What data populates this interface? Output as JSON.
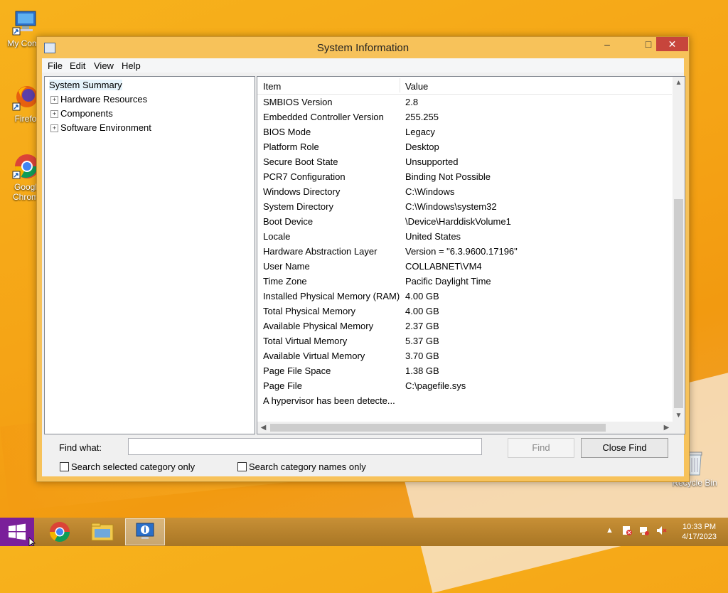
{
  "desktop": {
    "icons": [
      {
        "label": "My Comp",
        "icon": "computer-icon"
      },
      {
        "label": "Firefo",
        "icon": "firefox-icon"
      },
      {
        "label": "Googl",
        "label2": "Chrom",
        "icon": "chrome-icon"
      },
      {
        "label": "Recycle Bin",
        "icon": "recycle-bin-icon"
      }
    ]
  },
  "window": {
    "title": "System Information",
    "controls": {
      "minimize": "–",
      "maximize": "□",
      "close": "✕"
    },
    "menu": [
      "File",
      "Edit",
      "View",
      "Help"
    ]
  },
  "tree": {
    "root": "System Summary",
    "children": [
      "Hardware Resources",
      "Components",
      "Software Environment"
    ]
  },
  "list": {
    "columns": [
      "Item",
      "Value"
    ],
    "rows": [
      {
        "item": "SMBIOS Version",
        "value": "2.8"
      },
      {
        "item": "Embedded Controller Version",
        "value": "255.255"
      },
      {
        "item": "BIOS Mode",
        "value": "Legacy"
      },
      {
        "item": "Platform Role",
        "value": "Desktop"
      },
      {
        "item": "Secure Boot State",
        "value": "Unsupported"
      },
      {
        "item": "PCR7 Configuration",
        "value": "Binding Not Possible"
      },
      {
        "item": "Windows Directory",
        "value": "C:\\Windows"
      },
      {
        "item": "System Directory",
        "value": "C:\\Windows\\system32"
      },
      {
        "item": "Boot Device",
        "value": "\\Device\\HarddiskVolume1"
      },
      {
        "item": "Locale",
        "value": "United States"
      },
      {
        "item": "Hardware Abstraction Layer",
        "value": "Version = \"6.3.9600.17196\""
      },
      {
        "item": "User Name",
        "value": "COLLABNET\\VM4"
      },
      {
        "item": "Time Zone",
        "value": "Pacific Daylight Time"
      },
      {
        "item": "Installed Physical Memory (RAM)",
        "value": "4.00 GB"
      },
      {
        "item": "Total Physical Memory",
        "value": "4.00 GB"
      },
      {
        "item": "Available Physical Memory",
        "value": "2.37 GB"
      },
      {
        "item": "Total Virtual Memory",
        "value": "5.37 GB"
      },
      {
        "item": "Available Virtual Memory",
        "value": "3.70 GB"
      },
      {
        "item": "Page File Space",
        "value": "1.38 GB"
      },
      {
        "item": "Page File",
        "value": "C:\\pagefile.sys"
      },
      {
        "item": "A hypervisor has been detecte...",
        "value": ""
      }
    ]
  },
  "find": {
    "label": "Find what:",
    "value": "",
    "find_button": "Find",
    "close_button": "Close Find",
    "option1": "Search selected category only",
    "option2": "Search category names only"
  },
  "taskbar": {
    "apps": [
      "chrome-icon",
      "file-explorer-icon",
      "system-information-icon"
    ],
    "time": "10:33 PM",
    "date": "4/17/2023"
  }
}
